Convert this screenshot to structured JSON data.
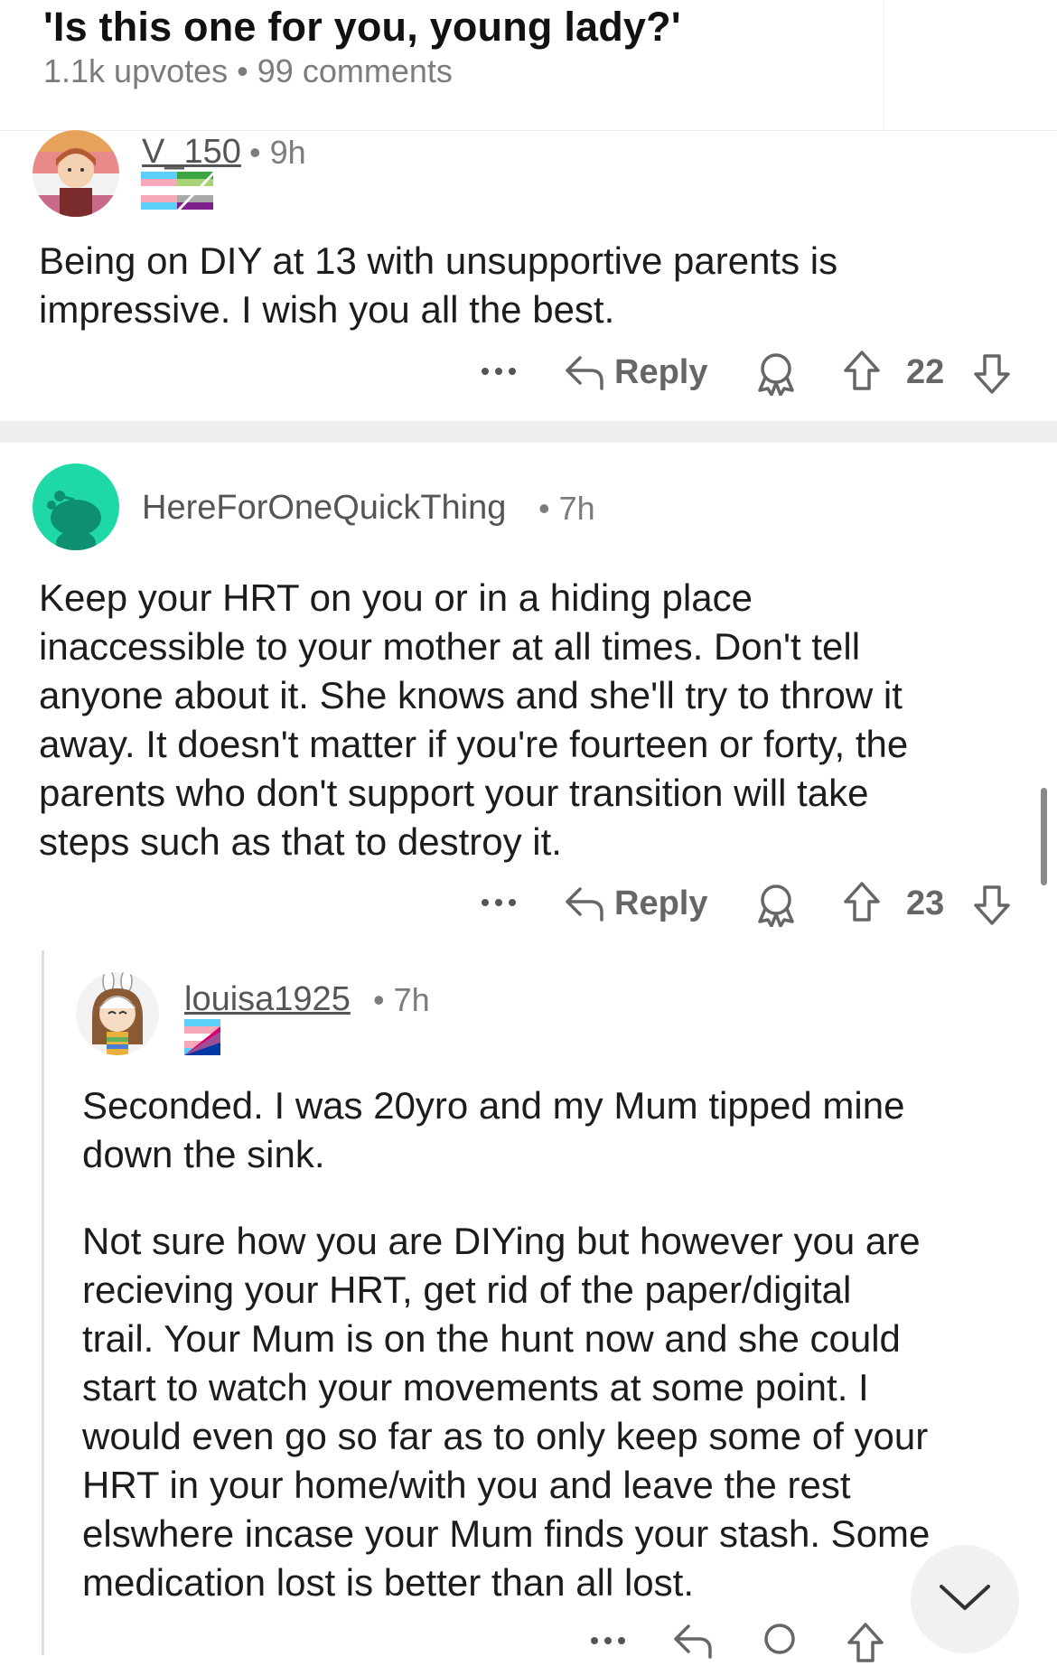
{
  "post": {
    "title": "'Is this one for you, young lady?'",
    "upvotes": "1.1k upvotes",
    "separator": "•",
    "comments": "99 comments"
  },
  "comments": [
    {
      "username": "V_150",
      "separator": "•",
      "time": "9h",
      "body": [
        "Being on DIY at 13 with unsupportive parents is",
        "impressive. I wish you all the best."
      ],
      "reply_label": "Reply",
      "score": "22"
    },
    {
      "username": "HereForOneQuickThing",
      "separator": "•",
      "time": "7h",
      "body": [
        "Keep your HRT on you or in a hiding place",
        "inaccessible to your mother at all times.  Don't tell",
        "anyone about it. She knows and she'll try to throw it",
        "away. It doesn't matter if you're fourteen or forty, the",
        "parents who don't support your transition will take",
        "steps such as that to destroy it."
      ],
      "reply_label": "Reply",
      "score": "23"
    },
    {
      "username": "louisa1925",
      "separator": "•",
      "time": "7h",
      "body": [
        "Seconded. I was 20yro and my Mum tipped mine",
        "down the sink.",
        "Not sure how you are DIYing but however you are",
        "recieving your HRT, get rid of the paper/digital",
        "trail. Your Mum is on the hunt now and she could",
        "start to watch your movements at some point. I",
        "would even go so far as to only keep some of your",
        "HRT in your home/with you and leave the rest",
        "elswhere incase your Mum finds your stash. Some",
        "medication lost is better than all lost."
      ]
    }
  ],
  "icons": {
    "more": "more-icon",
    "reply": "reply-arrow-icon",
    "award": "award-icon",
    "upvote": "upvote-icon",
    "downvote": "downvote-icon",
    "collapse": "chevron-down-icon"
  },
  "colors": {
    "avatar_green": "#1fd8a8",
    "text_muted": "#7c7c7c",
    "trans_blue": "#5bcefa",
    "trans_pink": "#f5a9b8"
  }
}
